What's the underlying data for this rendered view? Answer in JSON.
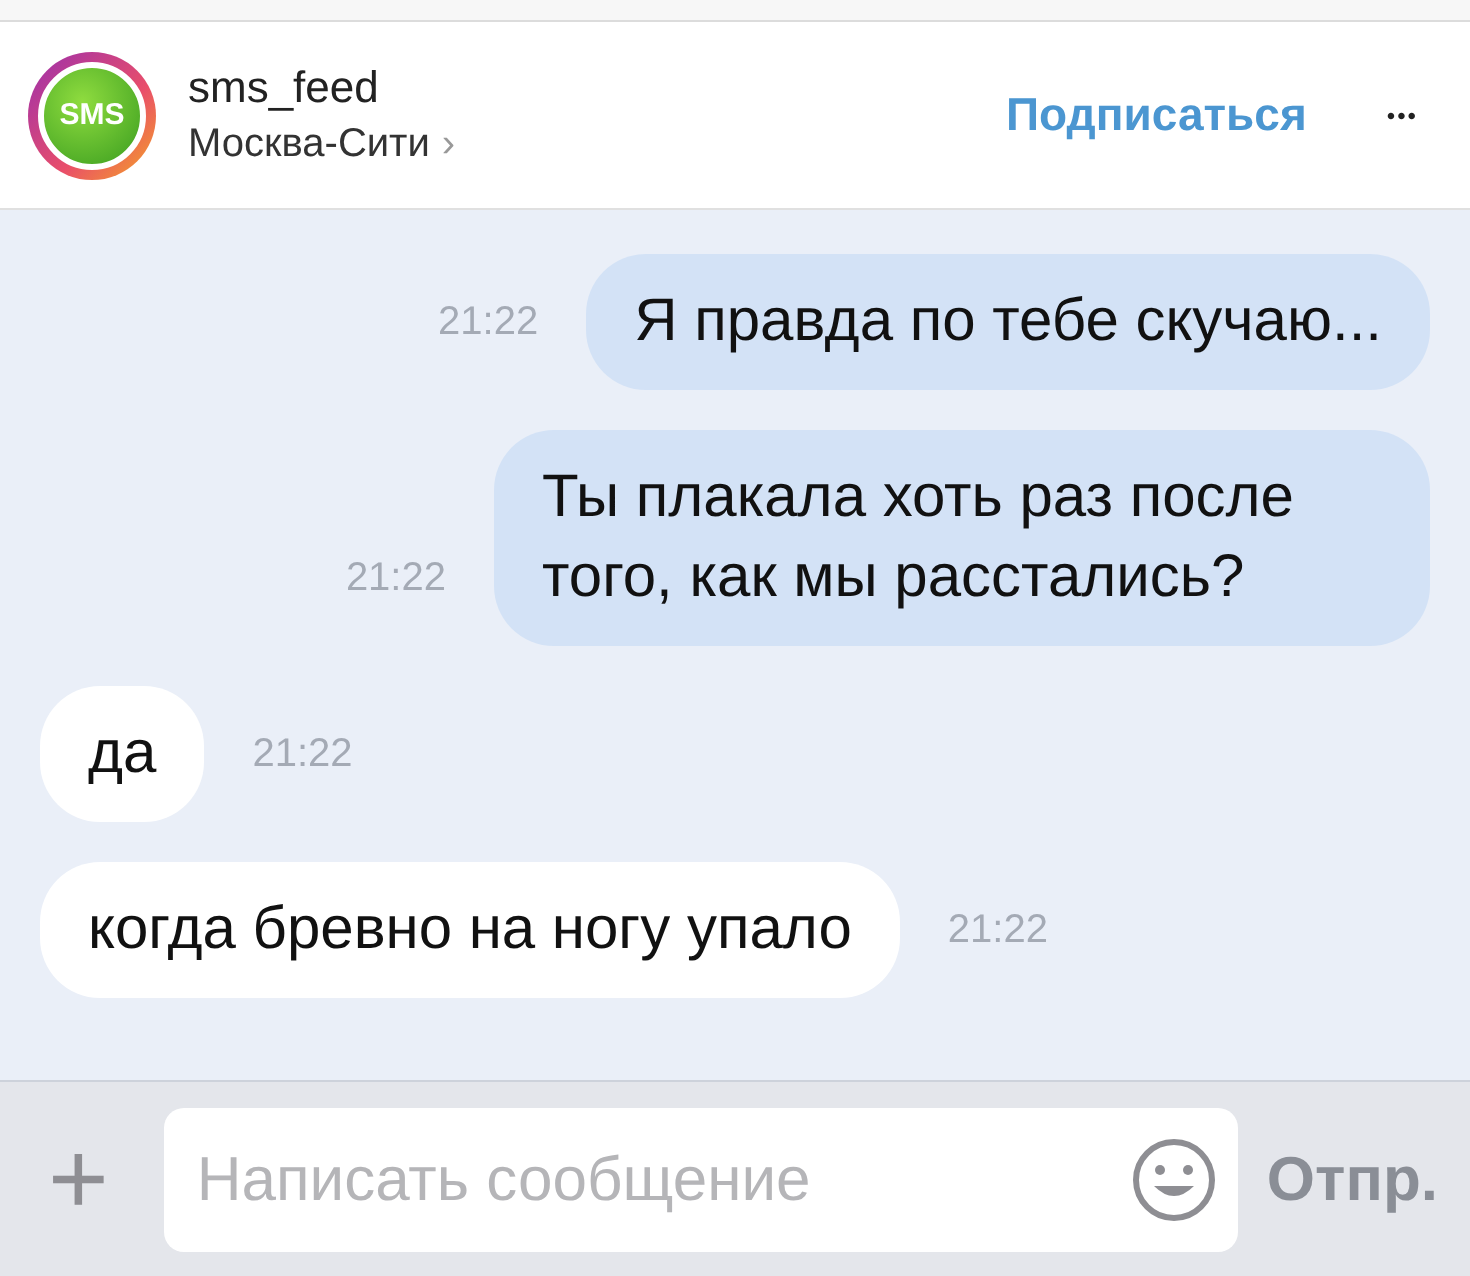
{
  "header": {
    "avatar_text": "SMS",
    "username": "sms_feed",
    "location": "Москва-Сити",
    "location_arrow": "›",
    "follow": "Подписаться",
    "more": "•••"
  },
  "messages": [
    {
      "kind": "sent",
      "text": "Я правда по тебе скучаю...",
      "time": "21:22"
    },
    {
      "kind": "sent",
      "text": "Ты плакала хоть раз после того, как мы расстались?",
      "time": "21:22"
    },
    {
      "kind": "received",
      "text": "да",
      "time": "21:22"
    },
    {
      "kind": "received",
      "text": "когда бревно на ногу упало",
      "time": "21:22"
    }
  ],
  "composer": {
    "plus": "+",
    "placeholder": "Написать сообщение",
    "send": "Отпр."
  }
}
